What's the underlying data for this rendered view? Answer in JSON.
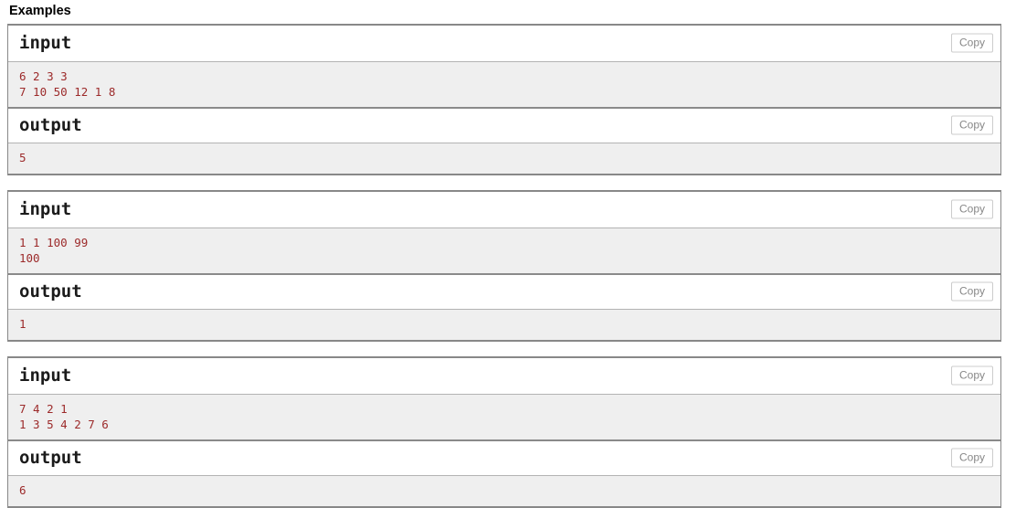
{
  "section": {
    "title": "Examples"
  },
  "labels": {
    "input": "input",
    "output": "output",
    "copy": "Copy"
  },
  "colors": {
    "code_text": "#9c2a2a",
    "code_background": "#efefef",
    "block_border": "#888888",
    "copy_border": "#cccccc",
    "copy_text": "#888888",
    "header_text": "#1b1b1b",
    "page_background": "#ffffff"
  },
  "examples": [
    {
      "input_label": "input",
      "output_label": "output",
      "copy_label": "Copy",
      "input": "6 2 3 3\n7 10 50 12 1 8",
      "output": "5"
    },
    {
      "input_label": "input",
      "output_label": "output",
      "copy_label": "Copy",
      "input": "1 1 100 99\n100",
      "output": "1"
    },
    {
      "input_label": "input",
      "output_label": "output",
      "copy_label": "Copy",
      "input": "7 4 2 1\n1 3 5 4 2 7 6",
      "output": "6"
    }
  ]
}
